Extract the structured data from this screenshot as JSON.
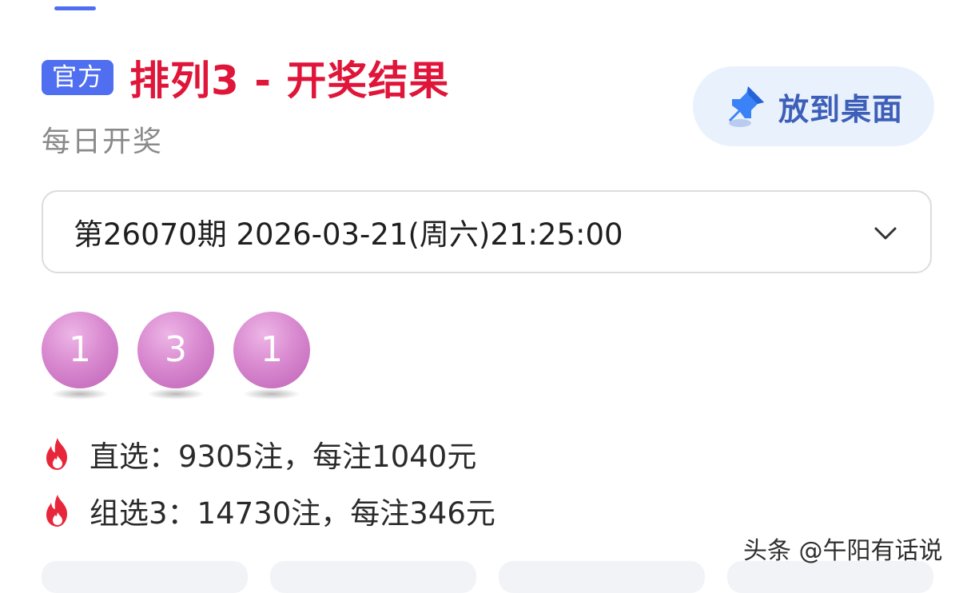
{
  "header": {
    "badge": "官方",
    "title": "排列3 - 开奖结果",
    "subtitle": "每日开奖"
  },
  "desktop_button": {
    "label": "放到桌面",
    "icon": "pin-icon"
  },
  "issue_selector": {
    "value": "第26070期 2026-03-21(周六)21:25:00",
    "icon": "chevron-down-icon"
  },
  "draw": {
    "numbers": [
      "1",
      "3",
      "1"
    ],
    "ball_color": "#d98ad0"
  },
  "prizes": [
    {
      "icon": "fire-icon",
      "text": "直选：9305注，每注1040元"
    },
    {
      "icon": "fire-icon",
      "text": "组选3：14730注，每注346元"
    }
  ],
  "watermark": "头条 @午阳有话说",
  "colors": {
    "accent_blue": "#4f6ef0",
    "title_red": "#e0153a",
    "button_bg": "#e9f1fd",
    "fire_red": "#e8263b"
  }
}
